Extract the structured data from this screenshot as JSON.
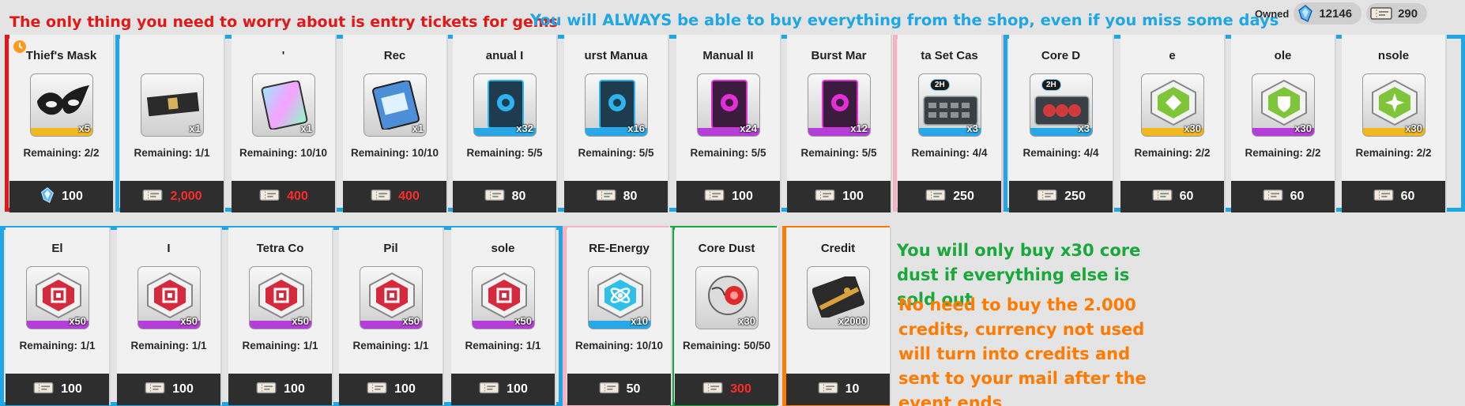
{
  "notes": {
    "top_left": "The only thing you need to worry about is entry tickets for gems",
    "top_mid": "You will ALWAYS be able to buy everything from the shop, even if you miss some days",
    "green": "You will only buy x30 core dust if everything else is sold out",
    "orange": "No need to buy the 2.000 credits, currency not used will turn into credits and sent to your mail after the event ends"
  },
  "owned": {
    "label": "Owned",
    "gems": "12146",
    "tickets": "290"
  },
  "colors": {
    "red": "#e01818",
    "blue": "#1ea7e6",
    "pink": "#f7b3c5",
    "green": "#19a83b",
    "orange": "#ff7a00",
    "rarity_gold": "#f2b820",
    "rarity_blue": "#27a8e8",
    "rarity_purple": "#b53ed9"
  },
  "row1": [
    {
      "name": "Thief's Mask",
      "qty": "x5",
      "remaining": "Remaining: 2/2",
      "price": "100",
      "currency": "gem-icon",
      "rarity": "gold",
      "icon": "mask-icon"
    },
    {
      "name": "",
      "qty": "x1",
      "remaining": "Remaining: 1/1",
      "price": "2,000",
      "currency": "ticket-icon",
      "rarity": "none",
      "icon": "ribbon-icon",
      "red": true
    },
    {
      "name": "'",
      "qty": "x1",
      "remaining": "Remaining: 10/10",
      "price": "400",
      "currency": "ticket-icon",
      "rarity": "none",
      "icon": "holo-card-icon",
      "red": true
    },
    {
      "name": "Rec",
      "qty": "x1",
      "remaining": "Remaining: 10/10",
      "price": "400",
      "currency": "ticket-icon",
      "rarity": "none",
      "icon": "recipe-card-icon",
      "red": true
    },
    {
      "name": "anual I",
      "qty": "x32",
      "remaining": "Remaining: 5/5",
      "price": "80",
      "currency": "ticket-icon",
      "rarity": "blue",
      "icon": "manual-blue-icon"
    },
    {
      "name": "urst Manua",
      "qty": "x16",
      "remaining": "Remaining: 5/5",
      "price": "80",
      "currency": "ticket-icon",
      "rarity": "blue",
      "icon": "burst-manual-blue-icon"
    },
    {
      "name": "Manual II",
      "qty": "x24",
      "remaining": "Remaining: 5/5",
      "price": "100",
      "currency": "ticket-icon",
      "rarity": "purple",
      "icon": "manual-purple-icon"
    },
    {
      "name": "Burst Mar",
      "qty": "x12",
      "remaining": "Remaining: 5/5",
      "price": "100",
      "currency": "ticket-icon",
      "rarity": "purple",
      "icon": "burst-manual-purple-icon"
    },
    {
      "name": "ta Set Cas",
      "qty": "x3",
      "remaining": "Remaining: 4/4",
      "price": "250",
      "currency": "ticket-icon",
      "rarity": "blue",
      "icon": "set-case-icon",
      "badge": "2H"
    },
    {
      "name": "Core D",
      "qty": "x3",
      "remaining": "Remaining: 4/4",
      "price": "250",
      "currency": "ticket-icon",
      "rarity": "blue",
      "icon": "core-case-icon",
      "badge": "2H"
    },
    {
      "name": "e",
      "qty": "x30",
      "remaining": "Remaining: 2/2",
      "price": "60",
      "currency": "ticket-icon",
      "rarity": "gold",
      "icon": "green-hex-icon"
    },
    {
      "name": "ole",
      "qty": "x30",
      "remaining": "Remaining: 2/2",
      "price": "60",
      "currency": "ticket-icon",
      "rarity": "purple",
      "icon": "green-shield-hex-icon"
    },
    {
      "name": "nsole",
      "qty": "x30",
      "remaining": "Remaining: 2/2",
      "price": "60",
      "currency": "ticket-icon",
      "rarity": "gold",
      "icon": "green-star-hex-icon"
    }
  ],
  "row2": [
    {
      "name": "El",
      "qty": "x50",
      "remaining": "Remaining: 1/1",
      "price": "100",
      "currency": "ticket-icon",
      "rarity": "purple",
      "icon": "red-hex-icon"
    },
    {
      "name": "I",
      "qty": "x50",
      "remaining": "Remaining: 1/1",
      "price": "100",
      "currency": "ticket-icon",
      "rarity": "purple",
      "icon": "red-hex-icon"
    },
    {
      "name": "Tetra Co",
      "qty": "x50",
      "remaining": "Remaining: 1/1",
      "price": "100",
      "currency": "ticket-icon",
      "rarity": "purple",
      "icon": "red-hex-icon"
    },
    {
      "name": "Pil",
      "qty": "x50",
      "remaining": "Remaining: 1/1",
      "price": "100",
      "currency": "ticket-icon",
      "rarity": "purple",
      "icon": "red-hex-icon"
    },
    {
      "name": "sole",
      "qty": "x50",
      "remaining": "Remaining: 1/1",
      "price": "100",
      "currency": "ticket-icon",
      "rarity": "purple",
      "icon": "red-hex-icon"
    },
    {
      "name": "RE-Energy",
      "qty": "x10",
      "remaining": "Remaining: 10/10",
      "price": "50",
      "currency": "ticket-icon",
      "rarity": "blue",
      "icon": "energy-hex-icon"
    },
    {
      "name": "Core Dust",
      "qty": "x30",
      "remaining": "Remaining: 50/50",
      "price": "300",
      "currency": "ticket-icon",
      "rarity": "none",
      "icon": "core-dust-icon",
      "red": true
    },
    {
      "name": "Credit",
      "qty": "x2000",
      "remaining": "",
      "price": "10",
      "currency": "ticket-icon",
      "rarity": "none",
      "icon": "credit-card-icon"
    }
  ]
}
